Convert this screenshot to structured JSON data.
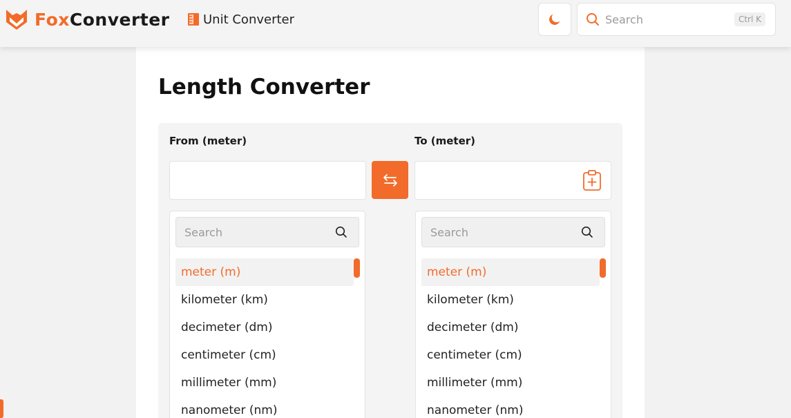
{
  "header": {
    "brand_part1": "Fox",
    "brand_part2": "Converter",
    "breadcrumb": "Unit Converter",
    "search_placeholder": "Search",
    "search_shortcut": "Ctrl K"
  },
  "page": {
    "title": "Length Converter"
  },
  "from": {
    "label": "From (meter)",
    "value": "",
    "search_placeholder": "Search",
    "units": [
      "meter (m)",
      "kilometer (km)",
      "decimeter (dm)",
      "centimeter (cm)",
      "millimeter (mm)",
      "nanometer (nm)"
    ],
    "selected": "meter (m)"
  },
  "to": {
    "label": "To (meter)",
    "value": "",
    "search_placeholder": "Search",
    "units": [
      "meter (m)",
      "kilometer (km)",
      "decimeter (dm)",
      "centimeter (cm)",
      "millimeter (mm)",
      "nanometer (nm)"
    ],
    "selected": "meter (m)"
  },
  "icons": {
    "logo": "fox-logo-icon",
    "breadcrumb": "ruler-icon",
    "theme": "moon-icon",
    "search": "search-icon",
    "swap": "swap-arrows-icon",
    "copy": "clipboard-plus-icon"
  },
  "colors": {
    "accent": "#f26b2a",
    "background": "#f2f2f2",
    "card": "#ffffff"
  }
}
